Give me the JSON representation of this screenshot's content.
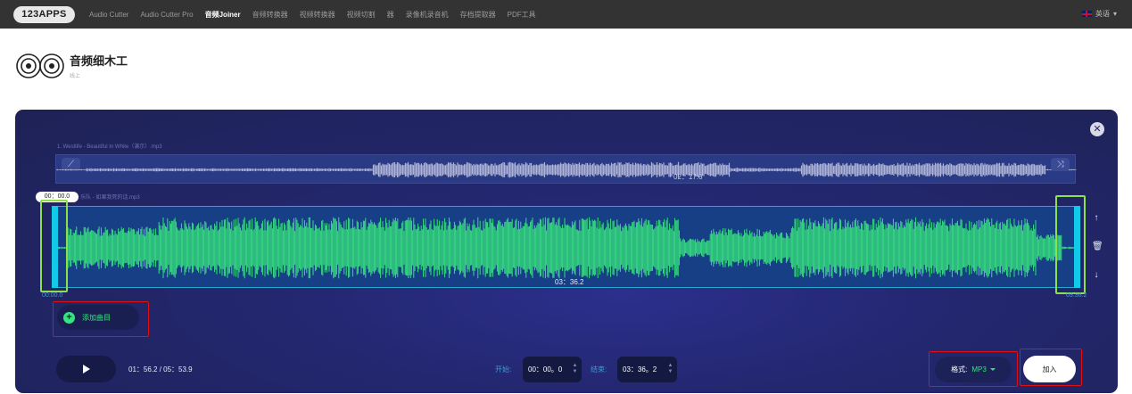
{
  "topbar": {
    "logo": "123APPS",
    "nav": [
      "Audio Cutter",
      "Audio Cutter Pro",
      "音频Joiner",
      "音频转换器",
      "视频转换器",
      "视频切割",
      "器",
      "录像机录音机",
      "存档提取器",
      "PDF工具"
    ],
    "active_index": 2,
    "language": "英语"
  },
  "brand": {
    "title": "音频细木工",
    "subtitle": "线上"
  },
  "editor": {
    "track1": {
      "label": "1. Westlife - Beautiful In White（演示）.mp3",
      "duration": "02：17.6"
    },
    "track2": {
      "label": "乐队 - 如果我死的话.mp3",
      "duration": "03：36.2",
      "start_bubble": "00：00.0",
      "time_start": "00:00.0",
      "time_end": "03:36.2"
    },
    "add_track": "添加曲目",
    "playback": "01：56.2 / 05：53.9",
    "start_label": "开始:",
    "start_value": "00：00。0",
    "end_label": "结束:",
    "end_value": "03：36。2",
    "format_label": "格式:",
    "format_value": "MP3",
    "join_label": "加入"
  },
  "colors": {
    "waveform": "#37e37f",
    "accent": "#13c9ea",
    "panel": "#23276f"
  }
}
